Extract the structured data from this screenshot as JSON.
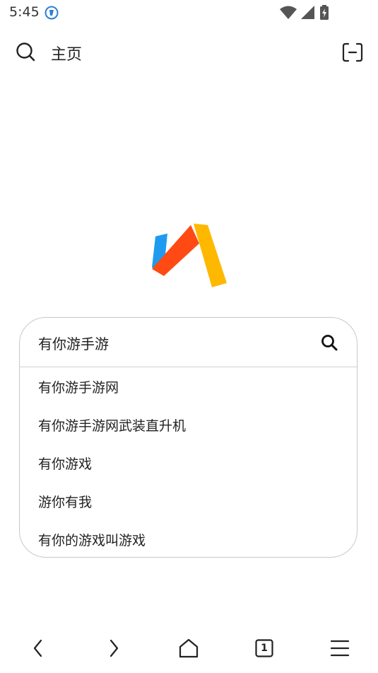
{
  "status_bar": {
    "time": "5:45"
  },
  "top_bar": {
    "title": "主页"
  },
  "search": {
    "query": "有你游手游",
    "suggestions": [
      "有你游手游网",
      "有你游手游网武装直升机",
      "有你游戏",
      "游你有我",
      "有你的游戏叫游戏"
    ]
  },
  "bottom_nav": {
    "tab_count": "1"
  },
  "colors": {
    "logo_blue": "#1E9BF0",
    "logo_red": "#FF4A14",
    "logo_yellow": "#FFB800",
    "border": "#c9c9c9"
  }
}
